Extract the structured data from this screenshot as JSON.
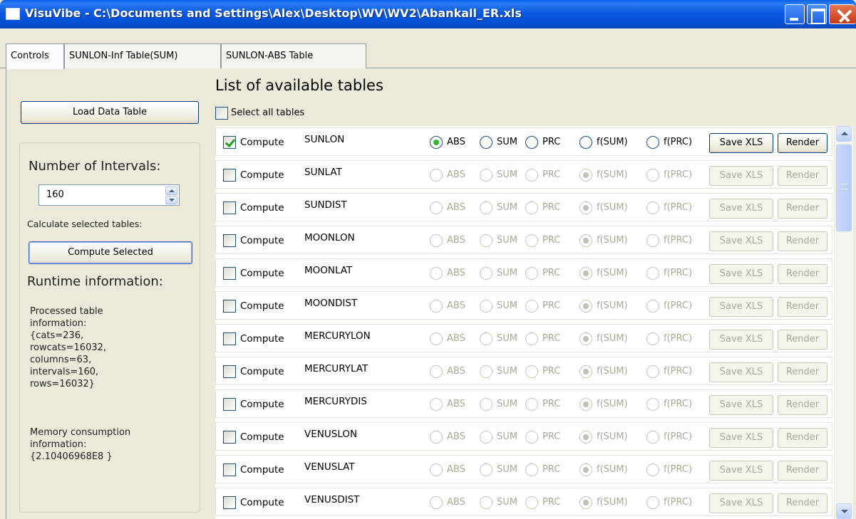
{
  "window": {
    "title": "VisuVibe - C:\\Documents and Settings\\Alex\\Desktop\\WV\\WV2\\Abankall_ER.xls"
  },
  "tabs": [
    {
      "label": "Controls",
      "active": true
    },
    {
      "label": "SUNLON-Inf Table(SUM)",
      "active": false
    },
    {
      "label": "SUNLON-ABS Table",
      "active": false
    }
  ],
  "controls": {
    "load_button": "Load Data Table",
    "intervals_label": "Number of Intervals:",
    "intervals_value": "160",
    "calc_label": "Calculate selected tables:",
    "compute_button": "Compute Selected",
    "runtime_label": "Runtime information:",
    "processed_info": "Processed table\ninformation:\n{cats=236,\nrowcats=16032,\ncolumns=63,\nintervals=160,\nrows=16032}",
    "memory_info": "Memory consumption\ninformation:\n {2.10406968E8 }"
  },
  "list": {
    "title": "List of available tables",
    "select_all_label": "Select all tables",
    "compute_label": "Compute",
    "modes": [
      "ABS",
      "SUM",
      "PRC",
      "f(SUM)",
      "f(PRC)"
    ],
    "save_label": "Save XLS",
    "render_label": "Render",
    "rows": [
      {
        "name": "SUNLON",
        "checked": true,
        "mode": "ABS"
      },
      {
        "name": "SUNLAT",
        "checked": false,
        "mode": "f(SUM)"
      },
      {
        "name": "SUNDIST",
        "checked": false,
        "mode": "f(SUM)"
      },
      {
        "name": "MOONLON",
        "checked": false,
        "mode": "f(SUM)"
      },
      {
        "name": "MOONLAT",
        "checked": false,
        "mode": "f(SUM)"
      },
      {
        "name": "MOONDIST",
        "checked": false,
        "mode": "f(SUM)"
      },
      {
        "name": "MERCURYLON",
        "checked": false,
        "mode": "f(SUM)"
      },
      {
        "name": "MERCURYLAT",
        "checked": false,
        "mode": "f(SUM)"
      },
      {
        "name": "MERCURYDIS",
        "checked": false,
        "mode": "f(SUM)"
      },
      {
        "name": "VENUSLON",
        "checked": false,
        "mode": "f(SUM)"
      },
      {
        "name": "VENUSLAT",
        "checked": false,
        "mode": "f(SUM)"
      },
      {
        "name": "VENUSDIST",
        "checked": false,
        "mode": "f(SUM)"
      }
    ]
  }
}
